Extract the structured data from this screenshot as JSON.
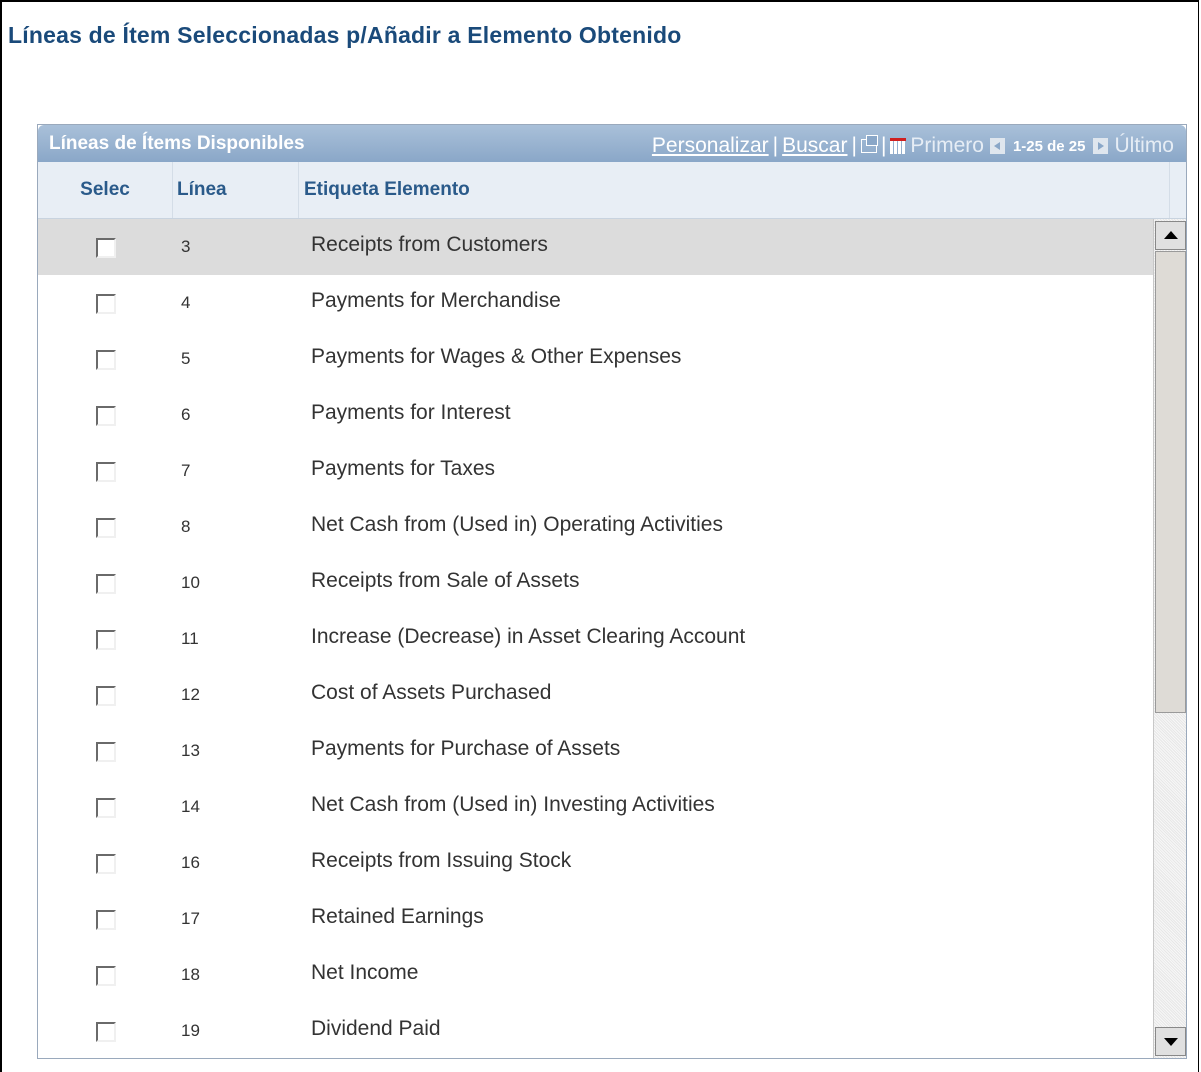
{
  "page": {
    "title": "Líneas de Ítem Seleccionadas p/Añadir a Elemento Obtenido"
  },
  "grid": {
    "title": "Líneas de Ítems Disponibles",
    "nav": {
      "customize": "Personalizar",
      "sep": "|",
      "find": "Buscar",
      "first": "Primero",
      "count": "1-25 de 25",
      "last": "Último"
    },
    "columns": {
      "select": "Selec",
      "line": "Línea",
      "label": "Etiqueta Elemento"
    },
    "rows": [
      {
        "line": "3",
        "label": "Receipts from Customers"
      },
      {
        "line": "4",
        "label": "Payments for Merchandise"
      },
      {
        "line": "5",
        "label": "Payments for Wages & Other Expenses"
      },
      {
        "line": "6",
        "label": "Payments for Interest"
      },
      {
        "line": "7",
        "label": "Payments for Taxes"
      },
      {
        "line": "8",
        "label": "Net Cash from (Used in) Operating Activities"
      },
      {
        "line": "10",
        "label": "Receipts from Sale of Assets"
      },
      {
        "line": "11",
        "label": "Increase (Decrease) in Asset Clearing Account"
      },
      {
        "line": "12",
        "label": "Cost of Assets Purchased"
      },
      {
        "line": "13",
        "label": "Payments for Purchase of Assets"
      },
      {
        "line": "14",
        "label": "Net Cash from (Used in) Investing Activities"
      },
      {
        "line": "16",
        "label": "Receipts from Issuing Stock"
      },
      {
        "line": "17",
        "label": "Retained Earnings"
      },
      {
        "line": "18",
        "label": "Net Income"
      },
      {
        "line": "19",
        "label": "Dividend Paid"
      }
    ]
  },
  "icons": {
    "popout": "new-window-icon",
    "grid": "download-grid-icon",
    "prev": "prev-arrow-icon",
    "next": "next-arrow-icon"
  },
  "colors": {
    "title": "#1a4a7a",
    "header": "#8aa7c8",
    "colhead_text": "#2a5a8a",
    "selected_row": "#dcdcdc"
  }
}
